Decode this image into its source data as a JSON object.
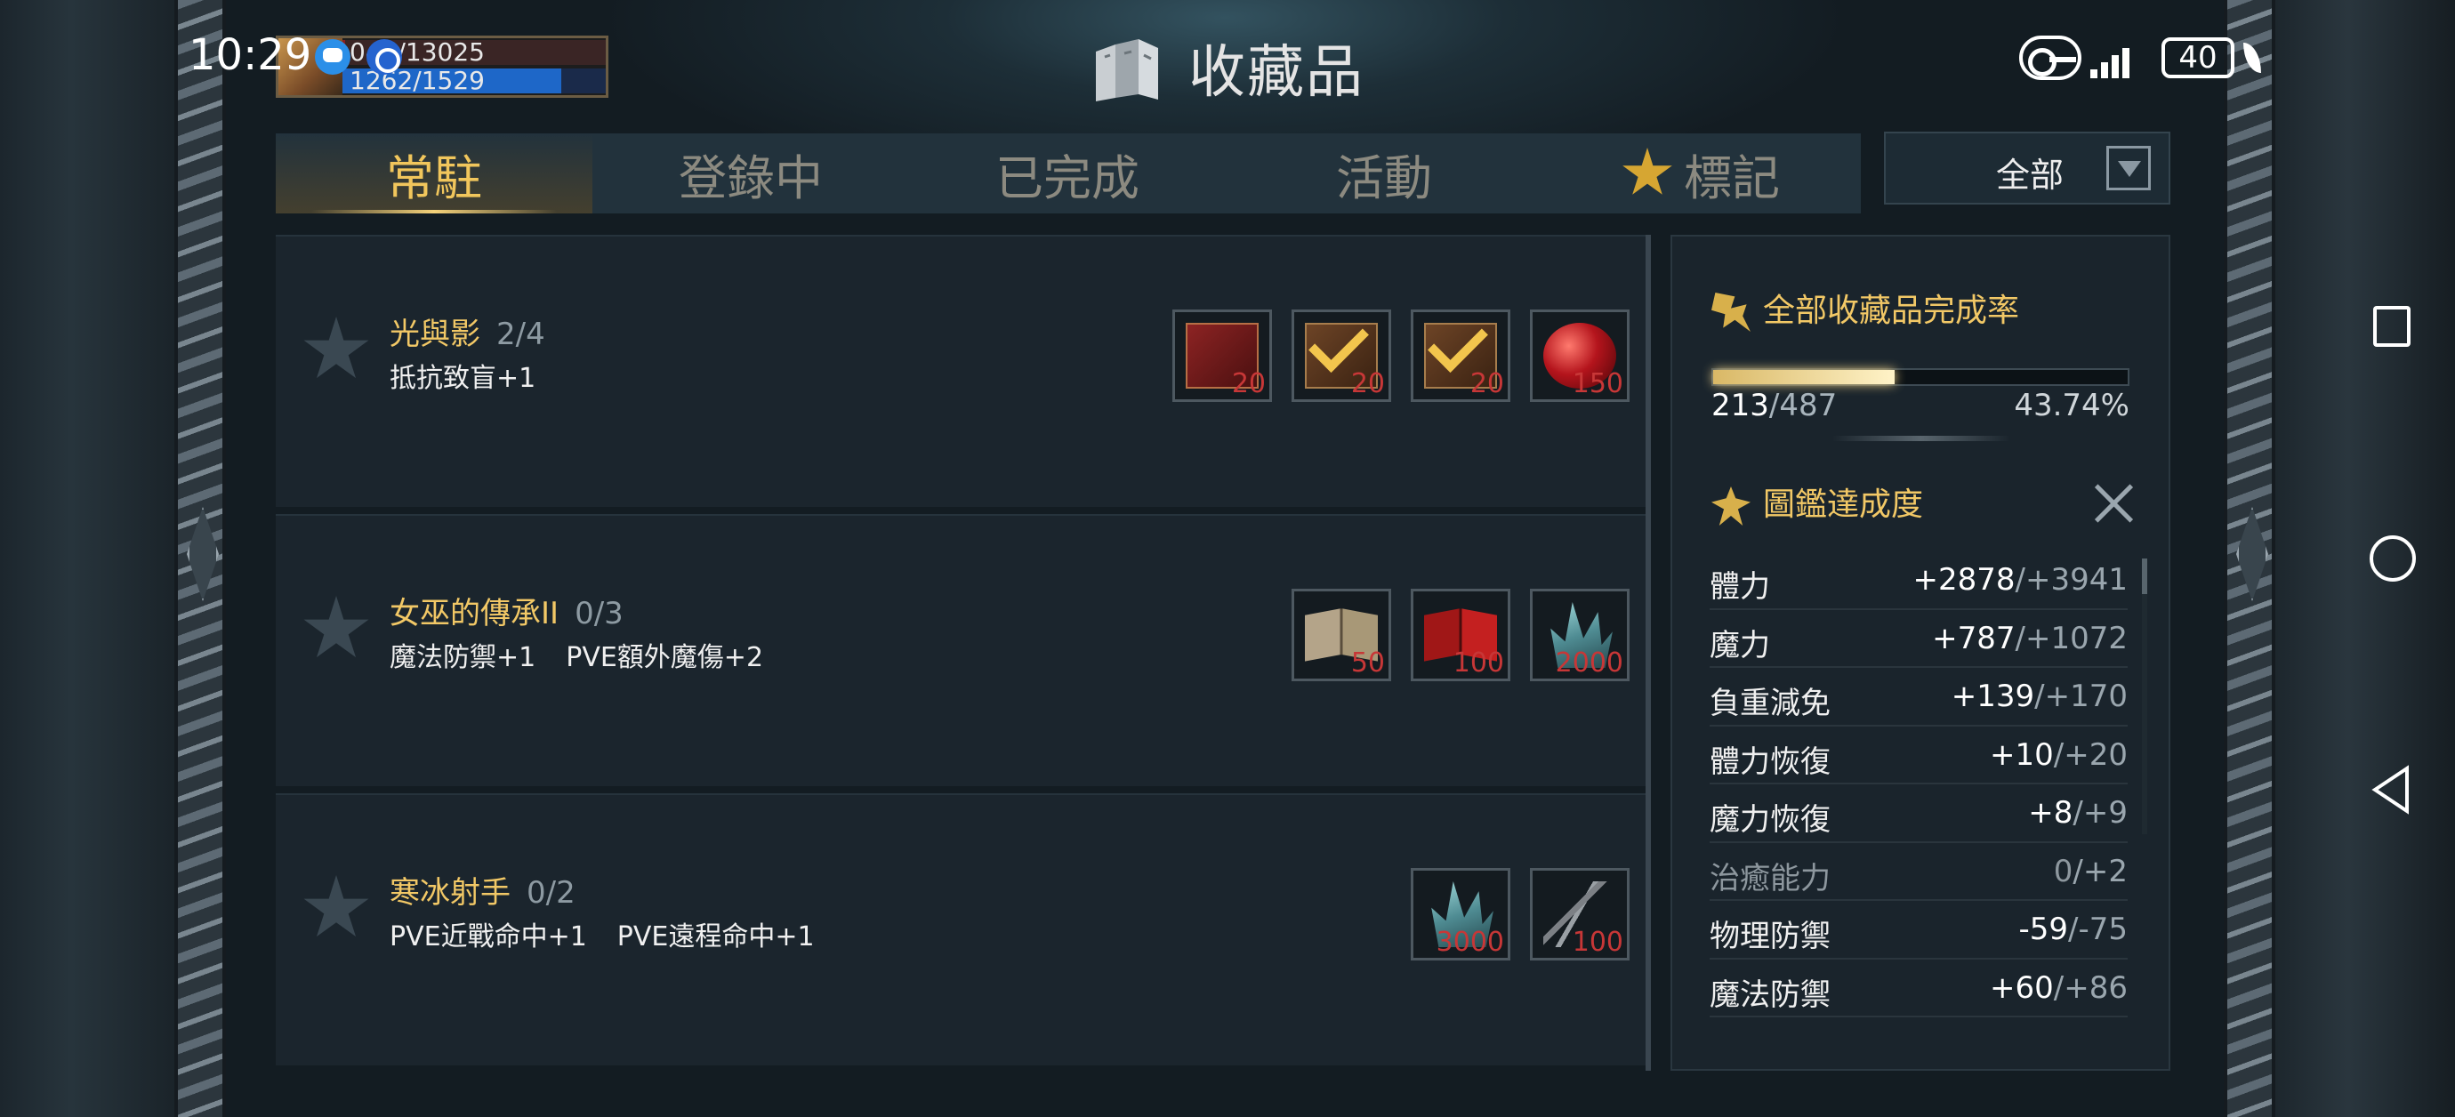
{
  "status_bar": {
    "time": "10:29",
    "battery": "40"
  },
  "player": {
    "hp_text": "042/13025",
    "mp_text": "1262/1529",
    "hp_fraction": 0.01,
    "mp_fraction": 0.83
  },
  "page": {
    "title": "收藏品"
  },
  "tabs": [
    {
      "label": "常駐",
      "active": true
    },
    {
      "label": "登錄中",
      "active": false
    },
    {
      "label": "已完成",
      "active": false
    },
    {
      "label": "活動",
      "active": false
    },
    {
      "label": "標記",
      "active": false,
      "icon": "star-icon"
    }
  ],
  "filter": {
    "selected": "全部"
  },
  "collections": [
    {
      "name": "光與影",
      "progress": "2/4",
      "effects": [
        "抵抗致盲+1"
      ],
      "items": [
        {
          "icon": "red-book-icon",
          "count": "20",
          "completed": false
        },
        {
          "icon": "brown-book-icon",
          "count": "20",
          "completed": true
        },
        {
          "icon": "brown-book-icon",
          "count": "20",
          "completed": true
        },
        {
          "icon": "apple-icon",
          "count": "150",
          "completed": false
        }
      ]
    },
    {
      "name": "女巫的傳承II",
      "progress": "0/3",
      "effects": [
        "魔法防禦+1",
        "PVE額外魔傷+2"
      ],
      "items": [
        {
          "icon": "open-book-icon",
          "count": "50",
          "completed": false
        },
        {
          "icon": "red-open-book-icon",
          "count": "100",
          "completed": false
        },
        {
          "icon": "crystal-icon",
          "count": "2000",
          "completed": false
        }
      ]
    },
    {
      "name": "寒冰射手",
      "progress": "0/2",
      "effects": [
        "PVE近戰命中+1",
        "PVE遠程命中+1"
      ],
      "items": [
        {
          "icon": "crystal-icon",
          "count": "3000",
          "completed": false
        },
        {
          "icon": "arrows-icon",
          "count": "100",
          "completed": false
        }
      ]
    }
  ],
  "summary": {
    "total_title": "全部收藏品完成率",
    "collected": "213",
    "total": "/487",
    "percent": "43.74%",
    "fill_fraction": 0.4374,
    "achievement_title": "圖鑑達成度"
  },
  "stats": [
    {
      "label": "體力",
      "value": "+2878",
      "max": "/+3941",
      "dim": false
    },
    {
      "label": "魔力",
      "value": "+787",
      "max": "/+1072",
      "dim": false
    },
    {
      "label": "負重減免",
      "value": "+139",
      "max": "/+170",
      "dim": false
    },
    {
      "label": "體力恢復",
      "value": "+10",
      "max": "/+20",
      "dim": false
    },
    {
      "label": "魔力恢復",
      "value": "+8",
      "max": "/+9",
      "dim": false
    },
    {
      "label": "治癒能力",
      "value": "0",
      "max": "/+2",
      "dim": true
    },
    {
      "label": "物理防禦",
      "value": "-59",
      "max": "/-75",
      "dim": false
    },
    {
      "label": "魔法防禦",
      "value": "+60",
      "max": "/+86",
      "dim": false
    }
  ]
}
